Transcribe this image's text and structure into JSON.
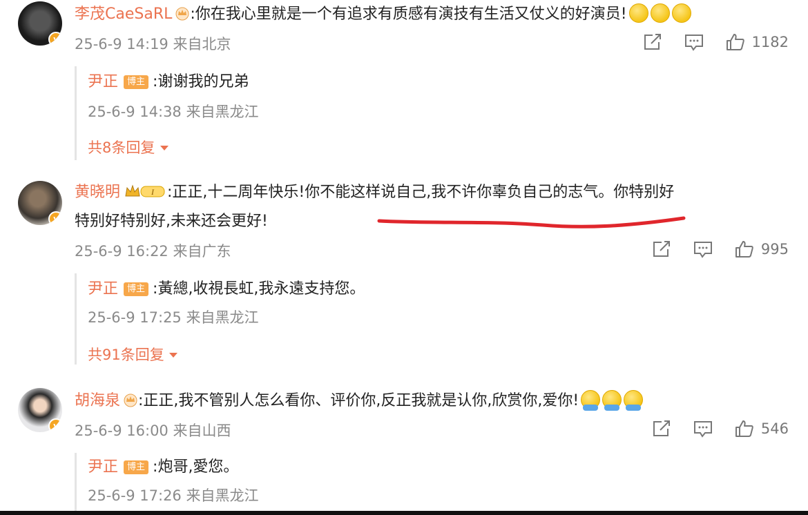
{
  "comments": [
    {
      "username": "李茂CaeSaRL",
      "text": ":你在我心里就是一个有追求有质感有演技有生活又仗义的好演员!",
      "emoji_count": 3,
      "emoji": "smile-emoji",
      "time": "25-6-9 14:19",
      "location": "来自北京",
      "likes": "1182",
      "reply": {
        "username": "尹正",
        "badge": "博主",
        "text": ":谢谢我的兄弟",
        "time": "25-6-9 14:38",
        "location": "来自黑龙江"
      },
      "more_replies": "共8条回复"
    },
    {
      "username": "黄晓明",
      "text_line1": ":正正,十二周年快乐!你不能这样说自己,我不许你辜负自己的志气。你特别好",
      "text_line2": "特别好特别好,未来还会更好!",
      "time": "25-6-9 16:22",
      "location": "来自广东",
      "likes": "995",
      "reply": {
        "username": "尹正",
        "badge": "博主",
        "text": ":黃總,收視長虹,我永遠支持您。",
        "time": "25-6-9 17:25",
        "location": "来自黑龙江"
      },
      "more_replies": "共91条回复"
    },
    {
      "username": "胡海泉",
      "text": ":正正,我不管别人怎么看你、评价你,反正我就是认你,欣赏你,爱你!",
      "emoji_count": 3,
      "emoji": "hug-emoji",
      "time": "25-6-9 16:00",
      "location": "来自山西",
      "likes": "546",
      "reply": {
        "username": "尹正",
        "badge": "博主",
        "text": ":炮哥,愛您。",
        "time": "25-6-9 17:26",
        "location": "来自黑龙江"
      }
    }
  ],
  "vip_level": "I",
  "colors": {
    "username": "#eb7350",
    "meta": "#8a8a8a",
    "badge": "#f7a74a",
    "annotation": "#e0262c"
  }
}
